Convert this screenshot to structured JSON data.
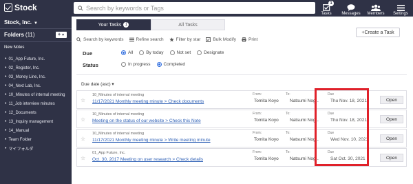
{
  "app": {
    "name": "Stock"
  },
  "search": {
    "placeholder": "Search by keywords or Tags"
  },
  "nav": [
    {
      "label": "Tasks",
      "icon": "tasks-check-icon",
      "badge": "1"
    },
    {
      "label": "Messages",
      "icon": "chat-bubble-icon"
    },
    {
      "label": "Members",
      "icon": "people-icon"
    },
    {
      "label": "Settings",
      "icon": "menu-icon"
    }
  ],
  "sidebar": {
    "team": "Stock, Inc.",
    "folders_label": "Folders",
    "folders_count": "(11)",
    "add_button": "+",
    "new_notes": "New Notes",
    "items": [
      "01_App Future, Inc.",
      "02_Register, Inc.",
      "03_Money Line, Inc.",
      "04_Next Lab, Inc.",
      "10_Minutes of internal meeting",
      "11_Job interview minutes",
      "12_Documents",
      "13_Inquiry management",
      "14_Manual",
      "Team Folder",
      "マイフォルダ"
    ]
  },
  "tabs": {
    "your_tasks": "Your Tasks",
    "your_tasks_badge": "1",
    "all_tasks": "All Tasks"
  },
  "create_button": "+Create a Task",
  "toolbar": {
    "search": "Search by keywords",
    "refine": "Refine search",
    "filter_star": "Filter by star",
    "bulk_modify": "Bulk Modify",
    "print": "Print"
  },
  "filters": {
    "due_label": "Due",
    "due_options": [
      "All",
      "By today",
      "Not set",
      "Designate"
    ],
    "due_selected": "All",
    "status_label": "Status",
    "status_options": [
      "In progress",
      "Completed"
    ],
    "status_selected": "Completed"
  },
  "sort_label": "Due date (asc) ▾",
  "columns": {
    "from": "From:",
    "to": "To:",
    "due": "Due"
  },
  "tasks": [
    {
      "folder": "10_Minutes of internal meeting",
      "title": "11/17/2021 Monthly meeting minute > Check documents",
      "from": "Tomita Koyo",
      "to": "Natsumi Nog...",
      "due": "Thu Nov. 18, 2021",
      "action": "Open"
    },
    {
      "folder": "10_Minutes of internal meeting",
      "title": "Meeting on the status of our website > Check this Note",
      "from": "Tomita Koyo",
      "to": "Natsumi Nog...",
      "due": "Thu Nov. 18, 2021",
      "action": "Open"
    },
    {
      "folder": "10_Minutes of internal meeting",
      "title": "11/17/2021 Monthly meeting minute > Write meeting minute",
      "from": "Tomita Koyo",
      "to": "Natsumi Nog...",
      "due": "Wed Nov. 10, 2021",
      "action": "Open"
    },
    {
      "folder": "01_App Future, Inc.",
      "title": "Oct. 30, 2017 Meeting on user research > Check details",
      "from": "Tomita Koyo",
      "to": "Natsumi Nog...",
      "due": "Sat Oct. 30, 2021",
      "action": "Open"
    }
  ],
  "colors": {
    "nav_bg": "#2f3246",
    "highlight": "#e0212a",
    "link": "#2d5fb5"
  }
}
